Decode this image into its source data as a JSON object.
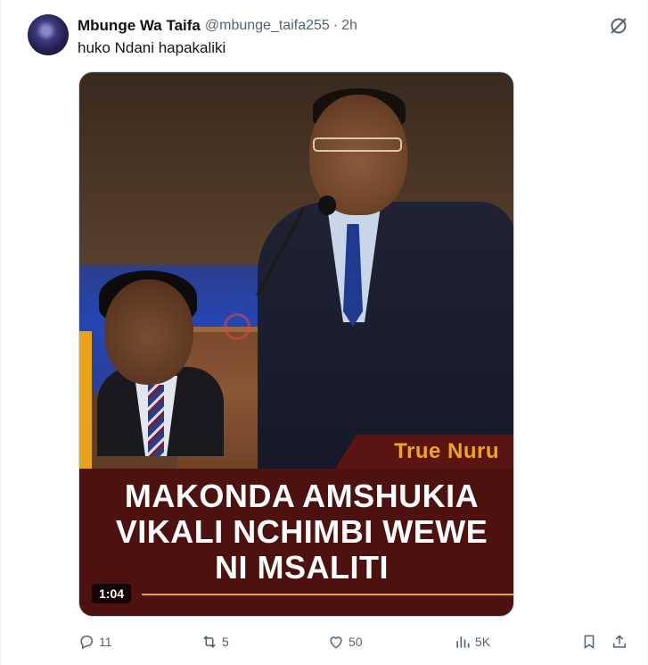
{
  "author": {
    "display_name": "Mbunge Wa Taifa",
    "handle": "@mbunge_taifa255",
    "separator": "·",
    "time_ago": "2h"
  },
  "tweet": {
    "text": "huko Ndani hapakaliki"
  },
  "media": {
    "brand": "True Nuru",
    "headline": "MAKONDA AMSHUKIA VIKALI NCHIMBI WEWE NI MSALITI",
    "duration": "1:04"
  },
  "actions": {
    "replies": "11",
    "reposts": "5",
    "likes": "50",
    "views": "5K"
  },
  "icons": {
    "grok": "grok-icon",
    "reply": "reply-icon",
    "repost": "repost-icon",
    "like": "heart-icon",
    "views": "views-icon",
    "bookmark": "bookmark-icon",
    "share": "share-icon"
  },
  "colors": {
    "muted": "#536471",
    "brand_accent": "#f0a61c",
    "banner_bg": "#4d1210"
  }
}
